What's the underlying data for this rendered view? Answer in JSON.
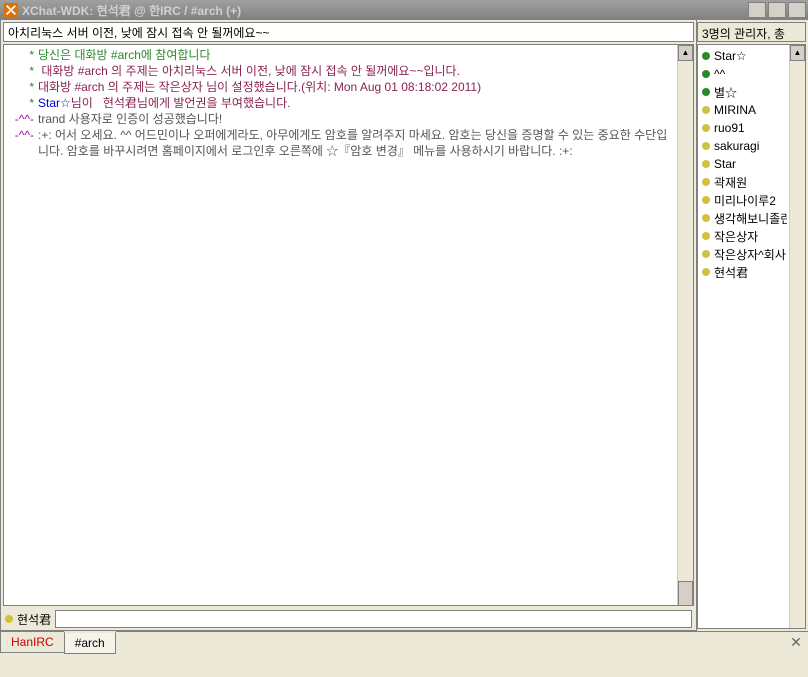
{
  "window": {
    "title": "XChat-WDK: 현석君 @ 한IRC / #arch (+)"
  },
  "topic": "아치리눅스 서버 이전, 낮에 잠시 접속 안 될꺼에요~~",
  "right_header": "3명의 관리자, 총",
  "chat": [
    {
      "prefix": "*",
      "prefix_class": "c-green",
      "msg_class": "c-green",
      "msg": "당신은 대화방 #arch에 참여합니다"
    },
    {
      "prefix": "*",
      "prefix_class": "c-green",
      "msg_class": "c-darkred",
      "msg": " 대화방 #arch 의 주제는 아치리눅스 서버 이전, 낮에 잠시 접속 안 될꺼에요~~입니다."
    },
    {
      "prefix": "*",
      "prefix_class": "c-green",
      "msg_class": "c-darkred",
      "msg": "대화방 #arch 의 주제는 작은상자 님이 설정했습니다.(위치: Mon Aug 01 08:18:02 2011)"
    },
    {
      "prefix": "*",
      "prefix_class": "c-green",
      "msg_class": "",
      "msg_html": "<span class='c-blue'>Star☆</span><span class='c-darkred'>님이   현석君님에게 발언권을 부여했습니다.</span>"
    },
    {
      "prefix": "-^^-",
      "prefix_class": "c-dotprefix",
      "msg_class": "c-gray",
      "msg": "trand 사용자로 인증이 성공했습니다!"
    },
    {
      "prefix": "-^^-",
      "prefix_class": "c-dotprefix",
      "msg_class": "c-gray",
      "msg": ":+: 어서 오세요. ^^ 어드민이나 오퍼에게라도, 아무에게도 암호를 알려주지 마세요. 암호는 당신을 증명할 수 있는 중요한 수단입니다. 암호를 바꾸시려면 홈페이지에서 로그인후 오른쪽에 ☆『암호 변경』 메뉴를 사용하시기 바랍니다. :+:"
    }
  ],
  "users": [
    {
      "dot": "dot-green",
      "name": "Star☆"
    },
    {
      "dot": "dot-green",
      "name": "^^"
    },
    {
      "dot": "dot-green",
      "name": "별☆"
    },
    {
      "dot": "dot-yellow",
      "name": "MIRINA"
    },
    {
      "dot": "dot-yellow",
      "name": "ruo91"
    },
    {
      "dot": "dot-yellow",
      "name": "sakuragi"
    },
    {
      "dot": "dot-yellow",
      "name": "Star"
    },
    {
      "dot": "dot-yellow",
      "name": "곽재원"
    },
    {
      "dot": "dot-yellow",
      "name": "미리나이루2"
    },
    {
      "dot": "dot-yellow",
      "name": "생각해보니졸린"
    },
    {
      "dot": "dot-yellow",
      "name": "작은상자"
    },
    {
      "dot": "dot-yellow",
      "name": "작은상자^회사"
    },
    {
      "dot": "dot-yellow",
      "name": "현석君"
    }
  ],
  "nick": "현석君",
  "tabs": [
    {
      "label": "HanIRC",
      "class": "inactive"
    },
    {
      "label": "#arch",
      "class": "active"
    }
  ],
  "winbtns": {
    "min": "_",
    "max": "□",
    "close": "×"
  }
}
